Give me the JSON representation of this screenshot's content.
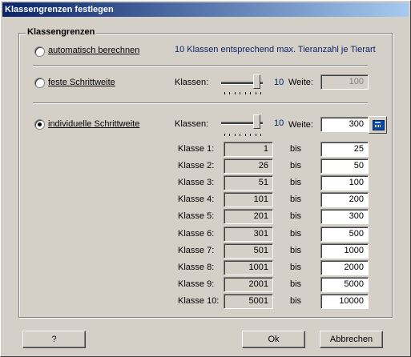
{
  "window": {
    "title": "Klassengrenzen festlegen"
  },
  "group": {
    "title": "Klassengrenzen"
  },
  "options": {
    "auto_label": "automatisch berechnen",
    "auto_info": "10 Klassen entsprechend max. Tieranzahl je Tierart",
    "fixed_label": "feste Schrittweite",
    "individual_label": "individuelle Schrittweite",
    "selected": "individuelle Schrittweite"
  },
  "fixed": {
    "klassen_label": "Klassen:",
    "klassen_value": "10",
    "weite_label": "Weite:",
    "weite_value": "100"
  },
  "individual": {
    "klassen_label": "Klassen:",
    "klassen_value": "10",
    "weite_label": "Weite:",
    "weite_value": "300"
  },
  "rows": [
    {
      "label": "Klasse 1:",
      "from": "1",
      "bis": "bis",
      "to": "25"
    },
    {
      "label": "Klasse 2:",
      "from": "26",
      "bis": "bis",
      "to": "50"
    },
    {
      "label": "Klasse 3:",
      "from": "51",
      "bis": "bis",
      "to": "100"
    },
    {
      "label": "Klasse 4:",
      "from": "101",
      "bis": "bis",
      "to": "200"
    },
    {
      "label": "Klasse 5:",
      "from": "201",
      "bis": "bis",
      "to": "300"
    },
    {
      "label": "Klasse 6:",
      "from": "301",
      "bis": "bis",
      "to": "500"
    },
    {
      "label": "Klasse 7:",
      "from": "501",
      "bis": "bis",
      "to": "1000"
    },
    {
      "label": "Klasse 8:",
      "from": "1001",
      "bis": "bis",
      "to": "2000"
    },
    {
      "label": "Klasse 9:",
      "from": "2001",
      "bis": "bis",
      "to": "5000"
    },
    {
      "label": "Klasse 10:",
      "from": "5001",
      "bis": "bis",
      "to": "10000"
    }
  ],
  "buttons": {
    "help": "?",
    "ok": "Ok",
    "cancel": "Abbrechen"
  },
  "icons": {
    "calculator": "calculator-icon"
  },
  "colors": {
    "title_start": "#0a246a",
    "title_end": "#a6caf0",
    "accent_text": "#0a246a",
    "face": "#d4d0c8"
  }
}
